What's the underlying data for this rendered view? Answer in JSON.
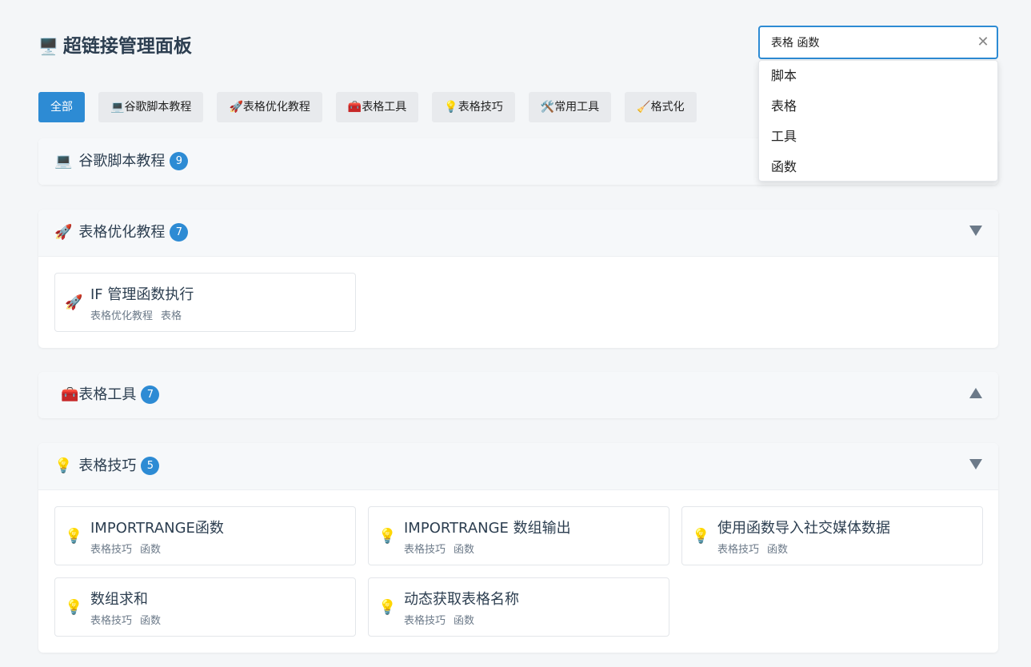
{
  "header": {
    "title_icon": "🖥️",
    "title": "超链接管理面板"
  },
  "search": {
    "value": "表格 函数",
    "placeholder": "",
    "suggestions": [
      "脚本",
      "表格",
      "工具",
      "函数"
    ]
  },
  "filters": [
    {
      "icon": "",
      "label": "全部",
      "active": true
    },
    {
      "icon": "💻",
      "label": "谷歌脚本教程",
      "active": false
    },
    {
      "icon": "🚀",
      "label": "表格优化教程",
      "active": false
    },
    {
      "icon": "🧰",
      "label": "表格工具",
      "active": false
    },
    {
      "icon": "💡",
      "label": "表格技巧",
      "active": false
    },
    {
      "icon": "🛠️",
      "label": "常用工具",
      "active": false
    },
    {
      "icon": "🧹",
      "label": "格式化",
      "active": false
    }
  ],
  "sections": [
    {
      "icon": "💻",
      "title": "谷歌脚本教程",
      "count": "9",
      "expanded": false,
      "arrow": "none",
      "cards": []
    },
    {
      "icon": "🚀",
      "title": "表格优化教程",
      "count": "7",
      "expanded": true,
      "arrow": "down",
      "cards": [
        {
          "icon": "🚀",
          "title": "IF 管理函数执行",
          "tags": [
            "表格优化教程",
            "表格"
          ]
        }
      ]
    },
    {
      "icon": "🧰",
      "title": "表格工具",
      "count": "7",
      "expanded": false,
      "arrow": "up",
      "cards": []
    },
    {
      "icon": "💡",
      "title": "表格技巧",
      "count": "5",
      "expanded": true,
      "arrow": "down",
      "cards": [
        {
          "icon": "💡",
          "title": "IMPORTRANGE函数",
          "tags": [
            "表格技巧",
            "函数"
          ]
        },
        {
          "icon": "💡",
          "title": "IMPORTRANGE 数组输出",
          "tags": [
            "表格技巧",
            "函数"
          ]
        },
        {
          "icon": "💡",
          "title": "使用函数导入社交媒体数据",
          "tags": [
            "表格技巧",
            "函数"
          ]
        },
        {
          "icon": "💡",
          "title": "数组求和",
          "tags": [
            "表格技巧",
            "函数"
          ]
        },
        {
          "icon": "💡",
          "title": "动态获取表格名称",
          "tags": [
            "表格技巧",
            "函数"
          ]
        }
      ]
    }
  ],
  "colors": {
    "accent": "#2d8bd4",
    "chip_bg": "#e8eaed",
    "text": "#2c3e50",
    "muted": "#6c7a89"
  }
}
